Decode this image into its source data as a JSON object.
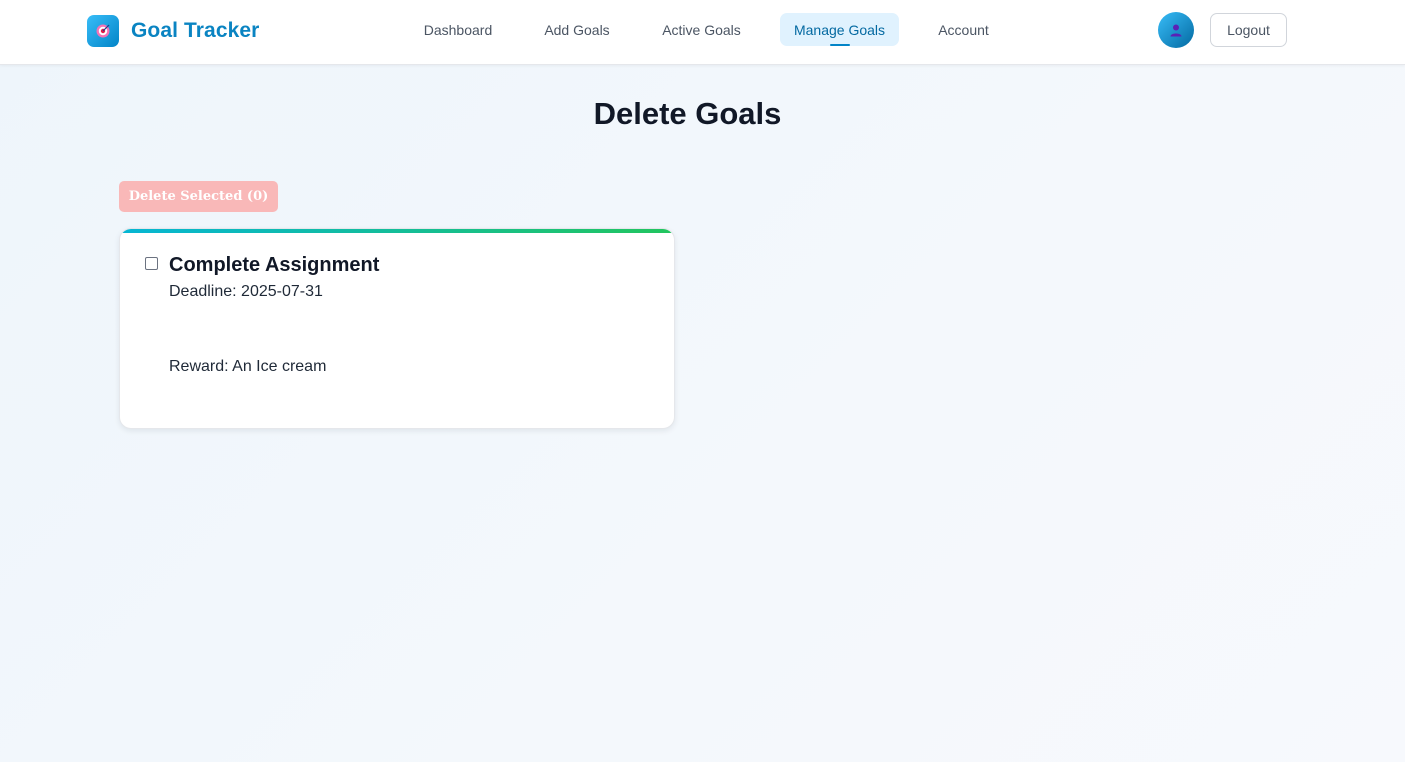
{
  "app": {
    "title": "Goal Tracker",
    "logo_icon": "target-icon"
  },
  "nav": {
    "links": [
      {
        "label": "Dashboard",
        "active": false
      },
      {
        "label": "Add Goals",
        "active": false
      },
      {
        "label": "Active Goals",
        "active": false
      },
      {
        "label": "Manage Goals",
        "active": true
      },
      {
        "label": "Account",
        "active": false
      }
    ]
  },
  "user": {
    "avatar_icon": "user-icon",
    "logout_label": "Logout"
  },
  "page": {
    "title": "Delete Goals",
    "delete_selected_label": "Delete Selected (0)",
    "selected_count": 0
  },
  "goals": [
    {
      "title": "Complete Assignment",
      "deadline": "Deadline: 2025-07-31",
      "reward": "Reward: An Ice cream",
      "checked": false
    }
  ],
  "colors": {
    "brand": "#0a84c2",
    "active_nav_bg": "#e0f2fe",
    "delete_button_disabled": "#f9b8b8",
    "card_accent_start": "#06b6d4",
    "card_accent_end": "#22c55e"
  }
}
